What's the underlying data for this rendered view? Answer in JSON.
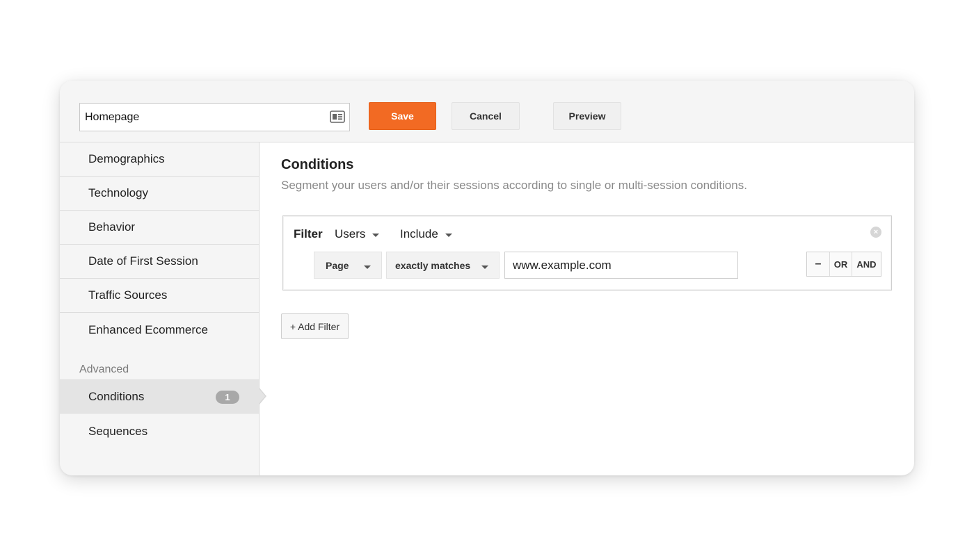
{
  "header": {
    "segment_name": "Homepage",
    "save_label": "Save",
    "cancel_label": "Cancel",
    "preview_label": "Preview",
    "save_color": "#f26a23"
  },
  "sidebar": {
    "items": [
      {
        "label": "Demographics"
      },
      {
        "label": "Technology"
      },
      {
        "label": "Behavior"
      },
      {
        "label": "Date of First Session"
      },
      {
        "label": "Traffic Sources"
      },
      {
        "label": "Enhanced Ecommerce"
      }
    ],
    "advanced_section": "Advanced",
    "advanced_items": [
      {
        "label": "Conditions",
        "badge": "1",
        "active": true
      },
      {
        "label": "Sequences"
      }
    ]
  },
  "main": {
    "title": "Conditions",
    "subtitle": "Segment your users and/or their sessions according to single or multi-session conditions.",
    "filter": {
      "label": "Filter",
      "scope": "Users",
      "mode": "Include",
      "dimension": "Page",
      "operator": "exactly matches",
      "value": "www.example.com",
      "ops": [
        "–",
        "OR",
        "AND"
      ]
    },
    "add_filter_label": "+ Add Filter"
  },
  "icons": {
    "name_field_icon": "contact-card-icon",
    "remove_filter_icon": "close-circle-icon",
    "dropdown_icon": "caret-down-icon"
  }
}
